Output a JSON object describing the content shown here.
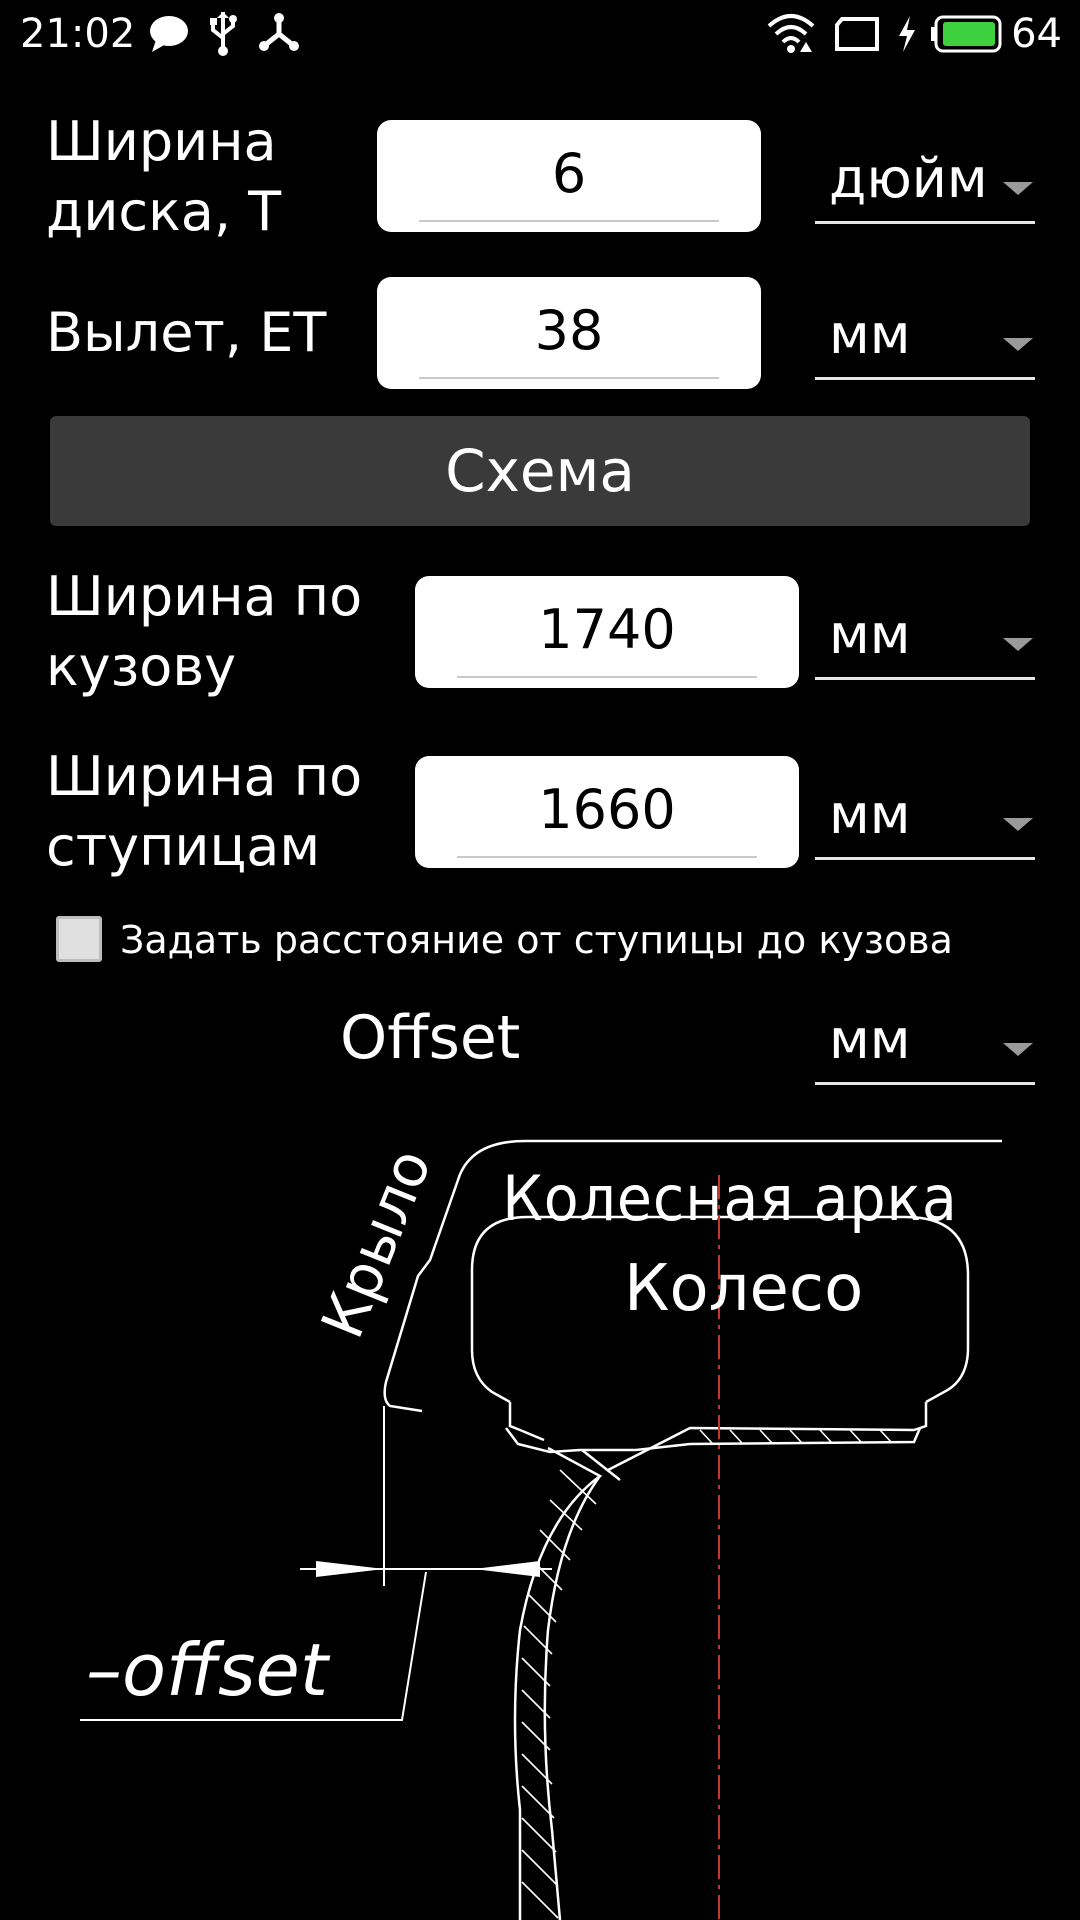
{
  "status_bar": {
    "time": "21:02",
    "battery_level": "64",
    "icons": [
      "chat-bubble-icon",
      "usb-icon",
      "share-icon",
      "wifi-icon",
      "screen-icon",
      "charging-icon",
      "battery-icon"
    ],
    "battery_color": "#3fd03f"
  },
  "form": {
    "rim_width": {
      "label": "Ширина\nдиска, Т",
      "value": "6",
      "unit": "дюйм"
    },
    "offset_et": {
      "label": "Вылет, ЕТ",
      "value": "38",
      "unit": "мм"
    },
    "scheme_button_label": "Схема",
    "body_width": {
      "label": "Ширина по\nкузову",
      "value": "1740",
      "unit": "мм"
    },
    "hub_width": {
      "label": "Ширина по\nступицам",
      "value": "1660",
      "unit": "мм"
    },
    "set_distance_checkbox": {
      "label": "Задать расстояние от ступицы до кузова",
      "checked": false
    },
    "offset_result": {
      "label": "Offset",
      "unit": "мм"
    }
  },
  "diagram": {
    "arch_label": "Колесная арка",
    "fender_label": "Крыло",
    "wheel_label": "Колесо",
    "offset_label": "–offset"
  },
  "colors": {
    "background": "#000000",
    "input_bg": "#ffffff",
    "button_bg": "#3a3a3a",
    "centerline": "#c0392b"
  }
}
